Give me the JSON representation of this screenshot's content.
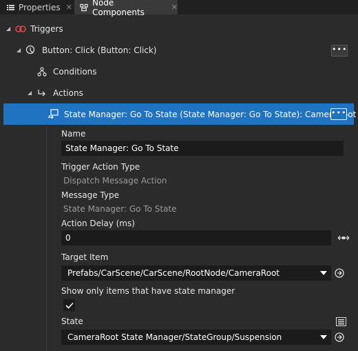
{
  "tabs": [
    {
      "label": "Properties",
      "icon": "list-icon"
    },
    {
      "label": "Node Components",
      "icon": "node-components-icon"
    }
  ],
  "tree": {
    "triggers": "Triggers",
    "button_click": "Button: Click (Button: Click)",
    "conditions": "Conditions",
    "actions": "Actions",
    "state_manager_action": "State Manager: Go To State (State Manager: Go To State): CameraRoot",
    "more_label": "•••"
  },
  "properties": {
    "name_label": "Name",
    "name_value": "State Manager: Go To State",
    "trigger_action_type_label": "Trigger Action Type",
    "trigger_action_type_value": "Dispatch Message Action",
    "message_type_label": "Message Type",
    "message_type_value": "State Manager: Go To State",
    "action_delay_label": "Action Delay (ms)",
    "action_delay_value": "0",
    "target_item_label": "Target Item",
    "target_item_value": "Prefabs/CarScene/CarScene/RootNode/CameraRoot",
    "show_only_label": "Show only items that have state manager",
    "show_only_checked": true,
    "state_label": "State",
    "state_value": "CameraRoot State Manager/StateGroup/Suspension"
  },
  "colors": {
    "selection": "#1f73c1",
    "background": "#2b2b2b",
    "field": "#1b1b1b"
  }
}
